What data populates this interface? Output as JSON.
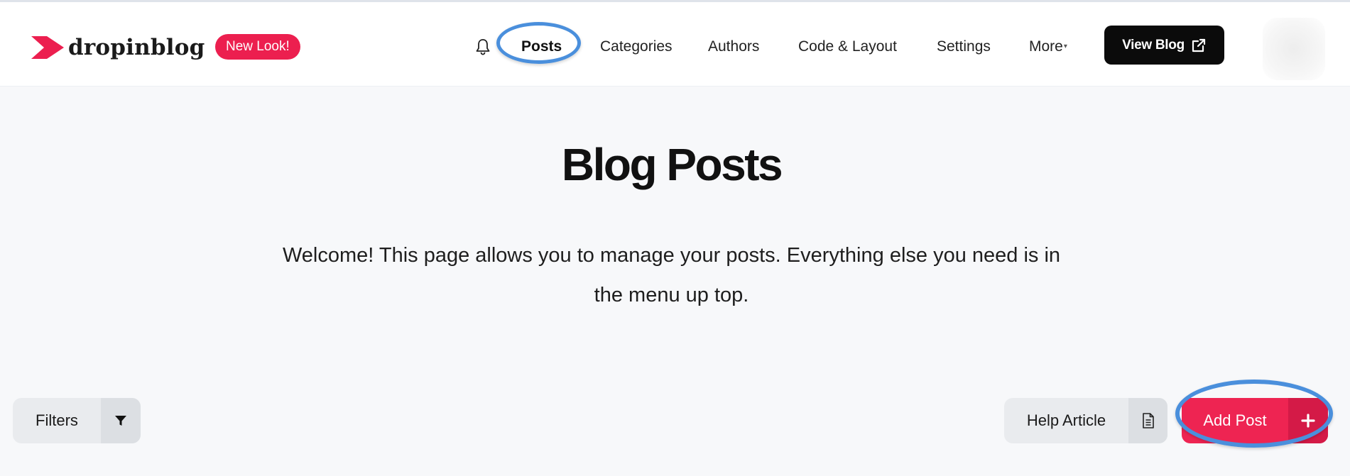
{
  "brand": {
    "name": "dropinblog",
    "accent": "#ec1f4f"
  },
  "header": {
    "badge": "New Look!",
    "bell_icon": "bell-icon",
    "nav": [
      {
        "label": "Posts",
        "active": true
      },
      {
        "label": "Categories"
      },
      {
        "label": "Authors"
      },
      {
        "label": "Code & Layout"
      },
      {
        "label": "Settings"
      },
      {
        "label": "More"
      }
    ],
    "view_blog": {
      "label": "View Blog",
      "icon": "external-link-icon"
    }
  },
  "main": {
    "title": "Blog Posts",
    "intro": "Welcome! This page allows you to manage your posts. Everything else you need is in the menu up top."
  },
  "toolbar": {
    "filters": {
      "label": "Filters",
      "icon": "filter-icon"
    },
    "help": {
      "label": "Help Article",
      "icon": "document-icon"
    },
    "add": {
      "label": "Add Post",
      "icon": "plus-icon"
    }
  },
  "colors": {
    "annotation": "#4a8fdc",
    "button_dark": "#0b0b0b",
    "button_gray": "#e9ebee"
  }
}
